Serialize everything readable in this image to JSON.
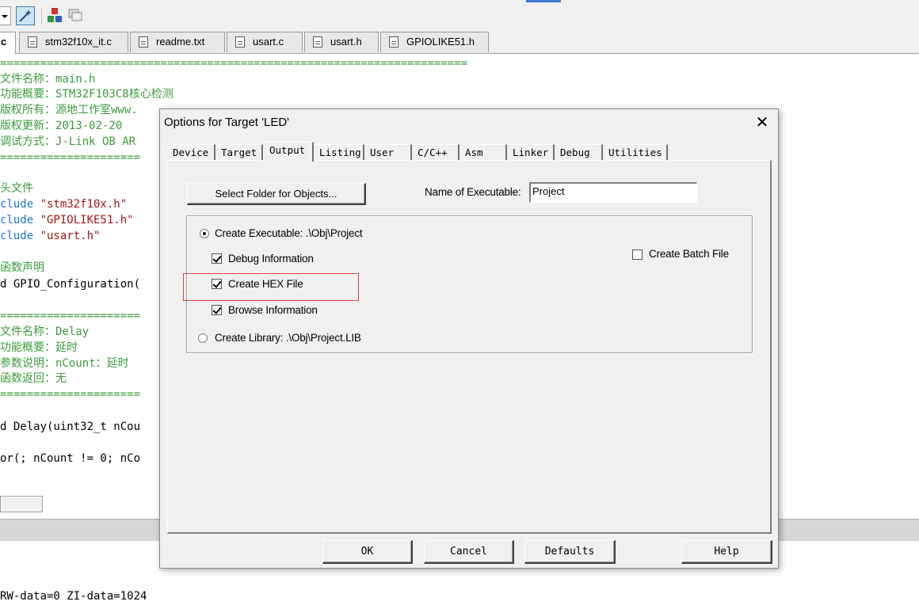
{
  "ide": {
    "tabs": [
      {
        "label": "c"
      },
      {
        "label": "stm32f10x_it.c"
      },
      {
        "label": "readme.txt"
      },
      {
        "label": "usart.c"
      },
      {
        "label": "usart.h"
      },
      {
        "label": "GPIOLIKE51.h"
      }
    ],
    "code_lines": [
      "======================================================================",
      "文件名称：main.h",
      "功能概要：STM32F103C8核心检测",
      "版权所有：源地工作室www.",
      "版权更新：2013-02-20",
      "调试方式：J-Link OB AR",
      "=====================",
      "头文件",
      "clude ",
      "\"stm32f10x.h\"",
      "clude ",
      "\"GPIOLIKE51.h\"",
      "clude ",
      "\"usart.h\"",
      "函数声明",
      "d GPIO_Configuration(",
      "=====================",
      "文件名称：Delay",
      "功能概要：延时",
      "参数说明：nCount：延时",
      "函数返回：无",
      "=====================",
      "d Delay(uint32_t nCou",
      "or(; nCount != 0; nCo"
    ],
    "output_line": "RW-data=0 ZI-data=1024"
  },
  "dialog": {
    "title": "Options for Target 'LED'",
    "close_glyph": "✕",
    "tabs": [
      "Device",
      "Target",
      "Output",
      "Listing",
      "User",
      "C/C++",
      "Asm",
      "Linker",
      "Debug",
      "Utilities"
    ],
    "active_tab": "Output",
    "select_folder_label": "Select Folder for Objects...",
    "name_exe_label": "Name of Executable:",
    "name_exe_value": "Project",
    "create_exe_label": "Create Executable:  .\\Obj\\Project",
    "debug_info_label": "Debug Information",
    "create_hex_label": "Create HEX File",
    "browse_info_label": "Browse Information",
    "create_lib_label": "Create Library:  .\\Obj\\Project.LIB",
    "create_batch_label": "Create Batch File",
    "states": {
      "create_executable": true,
      "create_library": false,
      "debug_information": true,
      "create_hex_file": true,
      "browse_information": true,
      "create_batch_file": false
    },
    "buttons": {
      "ok": "OK",
      "cancel": "Cancel",
      "defaults": "Defaults",
      "help": "Help"
    }
  },
  "colors": {
    "comment": "#3c9a3c",
    "string": "#a31515",
    "highlight_box": "#e04040",
    "dialog_bg": "#f0f0f0"
  }
}
